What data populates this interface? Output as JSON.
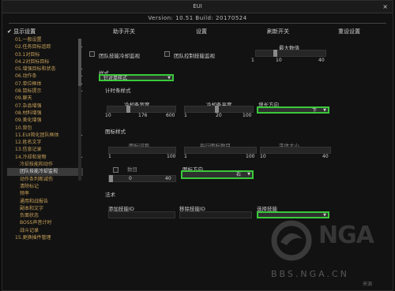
{
  "window": {
    "title": "EUI",
    "close_label": "×",
    "version": "Version: 10.51 Build: 20170524"
  },
  "sidebar": {
    "header": "显示设置",
    "items": [
      {
        "label": "01.一般设置",
        "plus": false
      },
      {
        "label": "02.任务目标追踪",
        "plus": true
      },
      {
        "label": "03.1对目标",
        "plus": false
      },
      {
        "label": "04.2对目标目标",
        "plus": false
      },
      {
        "label": "05.增强目标和状态",
        "plus": true
      },
      {
        "label": "06.动作条",
        "plus": true
      },
      {
        "label": "07.单位框体",
        "plus": true
      },
      {
        "label": "08.鼠标提示",
        "plus": true
      },
      {
        "label": "09.聊天",
        "plus": false
      },
      {
        "label": "07.杂品增强",
        "plus": false
      },
      {
        "label": "08.材料增强",
        "plus": false
      },
      {
        "label": "09.美化增强",
        "plus": false
      },
      {
        "label": "10.背包",
        "plus": false
      },
      {
        "label": "11.EUI简化团队框体",
        "plus": true
      },
      {
        "label": "12.姓名文字",
        "plus": false
      },
      {
        "label": "13.信息记录",
        "plus": false
      },
      {
        "label": "14.冷却和宠物",
        "plus": true
      },
      {
        "label": "冷却技能和动作",
        "plus": false,
        "sub": true
      },
      {
        "label": "团队技能冷却监视",
        "plus": false,
        "sub": true,
        "selected": true
      },
      {
        "label": "动作条判断减伤",
        "plus": false,
        "sub": true
      },
      {
        "label": "清除标记",
        "plus": false,
        "sub": true
      },
      {
        "label": "频率",
        "plus": false,
        "sub": true
      },
      {
        "label": "通用和战报告",
        "plus": false,
        "sub": true
      },
      {
        "label": "副本和文字",
        "plus": false,
        "sub": true
      },
      {
        "label": "负面状态",
        "plus": false,
        "sub": true
      },
      {
        "label": "BOSS声音计时",
        "plus": false,
        "sub": true
      },
      {
        "label": "战斗记录",
        "plus": false,
        "sub": true
      },
      {
        "label": "15.更换插件管理",
        "plus": false
      }
    ]
  },
  "tabs": [
    "助手开关",
    "设置",
    "刷新开关",
    "重设设置"
  ],
  "panel": {
    "cb1": "团队技能冷却监视",
    "cb2": "团队控制技能监视",
    "max_label": "最大数值",
    "max_min": "1",
    "max_val": "10",
    "max_max": "40",
    "style_label": "样式",
    "style_value": "针对单样式",
    "sec_growth": "计时条样式",
    "w_label": "冷却条宽度",
    "w_min": "10",
    "w_val": "176",
    "w_max": "600",
    "h_label": "冷却条高度",
    "h_min": "1",
    "h_val": "20",
    "h_max": "100",
    "grow_label": "增长方向",
    "grow_value": "下",
    "sec_icon": "图标样式",
    "ic1": "图标间距",
    "ic1_min": "1",
    "ic1_max": "100",
    "ic2": "每行图标数目",
    "ic2_min": "1",
    "ic2_max": "100",
    "ic3": "字体大小",
    "ic3_min": "10",
    "ic3_max": "40",
    "count_label": "数目",
    "count_val": "0",
    "count_max": "40",
    "anchor_label": "图标方向",
    "anchor_value": "右",
    "sec_add": "法术",
    "add_label": "添加技能ID",
    "rem_label": "移除技能ID",
    "choose_label": "选择技能",
    "choose_value": ""
  },
  "watermark": {
    "brand": "NGA",
    "url": "BBS.NGA.CN",
    "corner": "来源"
  }
}
